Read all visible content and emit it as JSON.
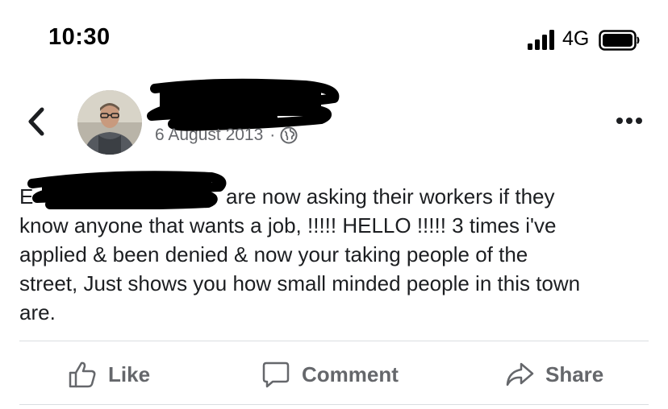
{
  "status_bar": {
    "time": "10:30",
    "network": "4G"
  },
  "post": {
    "date": "6 August 2013",
    "separator": "·",
    "visibility_icon": "globe-icon",
    "text_prefix": "E",
    "text": "are now asking their workers if they\nknow anyone that wants a job, !!!!! HELLO !!!!! 3 times i've\napplied & been denied & now your taking people of the\nstreet, Just shows you how small minded people in this town\nare."
  },
  "actions": {
    "like_label": "Like",
    "comment_label": "Comment",
    "share_label": "Share"
  },
  "colors": {
    "text": "#1c1e21",
    "secondary": "#65676b",
    "divider": "#dadde1"
  }
}
